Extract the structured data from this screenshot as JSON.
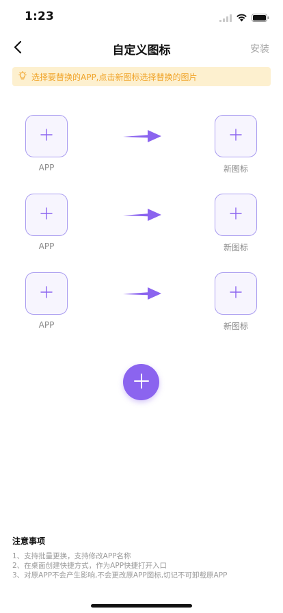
{
  "status_bar": {
    "time": "1:23"
  },
  "nav": {
    "title": "自定义图标",
    "install_label": "安装"
  },
  "tip": {
    "text": "选择要替换的APP,点击新图标选择替换的图片"
  },
  "rows": [
    {
      "left_label": "APP",
      "right_label": "新图标"
    },
    {
      "left_label": "APP",
      "right_label": "新图标"
    },
    {
      "left_label": "APP",
      "right_label": "新图标"
    }
  ],
  "notes": {
    "title": "注意事项",
    "items": [
      "1、支持批量更换，支持修改APP名称",
      "2、在桌面创建快捷方式，作为APP快捷打开入口",
      "3、对原APP不会产生影响,不会更改原APP图标,切记不可卸载原APP"
    ]
  },
  "colors": {
    "accent": "#8b64ef",
    "slot_border": "#a99cf0",
    "tip_bg": "#fdf0cf",
    "tip_text": "#f0a328"
  }
}
